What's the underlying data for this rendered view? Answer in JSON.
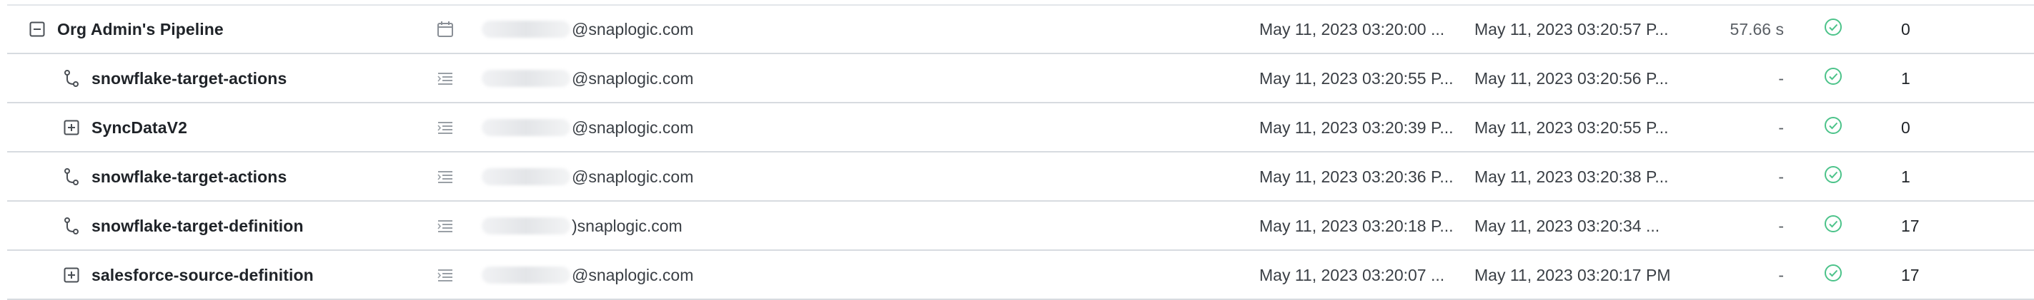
{
  "rows": [
    {
      "name": "Org Admin's Pipeline",
      "type_icon": "minus-square-icon",
      "detail_icon": "calendar-icon",
      "email_suffix": "@snaplogic.com",
      "start": "May 11, 2023 03:20:00 ...",
      "end": "May 11, 2023 03:20:57 P...",
      "duration": "57.66 s",
      "status_icon": "check-circle-icon",
      "count": "0",
      "indent": false
    },
    {
      "name": "snowflake-target-actions",
      "type_icon": "branch-icon",
      "detail_icon": "list-icon",
      "email_suffix": "@snaplogic.com",
      "start": "May 11, 2023 03:20:55 P...",
      "end": "May 11, 2023 03:20:56 P...",
      "duration": "-",
      "status_icon": "check-circle-icon",
      "count": "1",
      "indent": true
    },
    {
      "name": "SyncDataV2",
      "type_icon": "plus-square-icon",
      "detail_icon": "list-icon",
      "email_suffix": "@snaplogic.com",
      "start": "May 11, 2023 03:20:39 P...",
      "end": "May 11, 2023 03:20:55 P...",
      "duration": "-",
      "status_icon": "check-circle-icon",
      "count": "0",
      "indent": true
    },
    {
      "name": "snowflake-target-actions",
      "type_icon": "branch-icon",
      "detail_icon": "list-icon",
      "email_suffix": "@snaplogic.com",
      "start": "May 11, 2023 03:20:36 P...",
      "end": "May 11, 2023 03:20:38 P...",
      "duration": "-",
      "status_icon": "check-circle-icon",
      "count": "1",
      "indent": true
    },
    {
      "name": "snowflake-target-definition",
      "type_icon": "branch-icon",
      "detail_icon": "list-icon",
      "email_suffix": ")snaplogic.com",
      "start": "May 11, 2023 03:20:18 P...",
      "end": "May 11, 2023 03:20:34 ...",
      "duration": "-",
      "status_icon": "check-circle-icon",
      "count": "17",
      "indent": true
    },
    {
      "name": "salesforce-source-definition",
      "type_icon": "plus-square-icon",
      "detail_icon": "list-icon",
      "email_suffix": "@snaplogic.com",
      "start": "May 11, 2023 03:20:07 ...",
      "end": "May 11, 2023 03:20:17 PM",
      "duration": "-",
      "status_icon": "check-circle-icon",
      "count": "17",
      "indent": true
    }
  ],
  "colors": {
    "success": "#4cc38a",
    "divider": "#d7dbe0",
    "icon": "#7b8087"
  }
}
